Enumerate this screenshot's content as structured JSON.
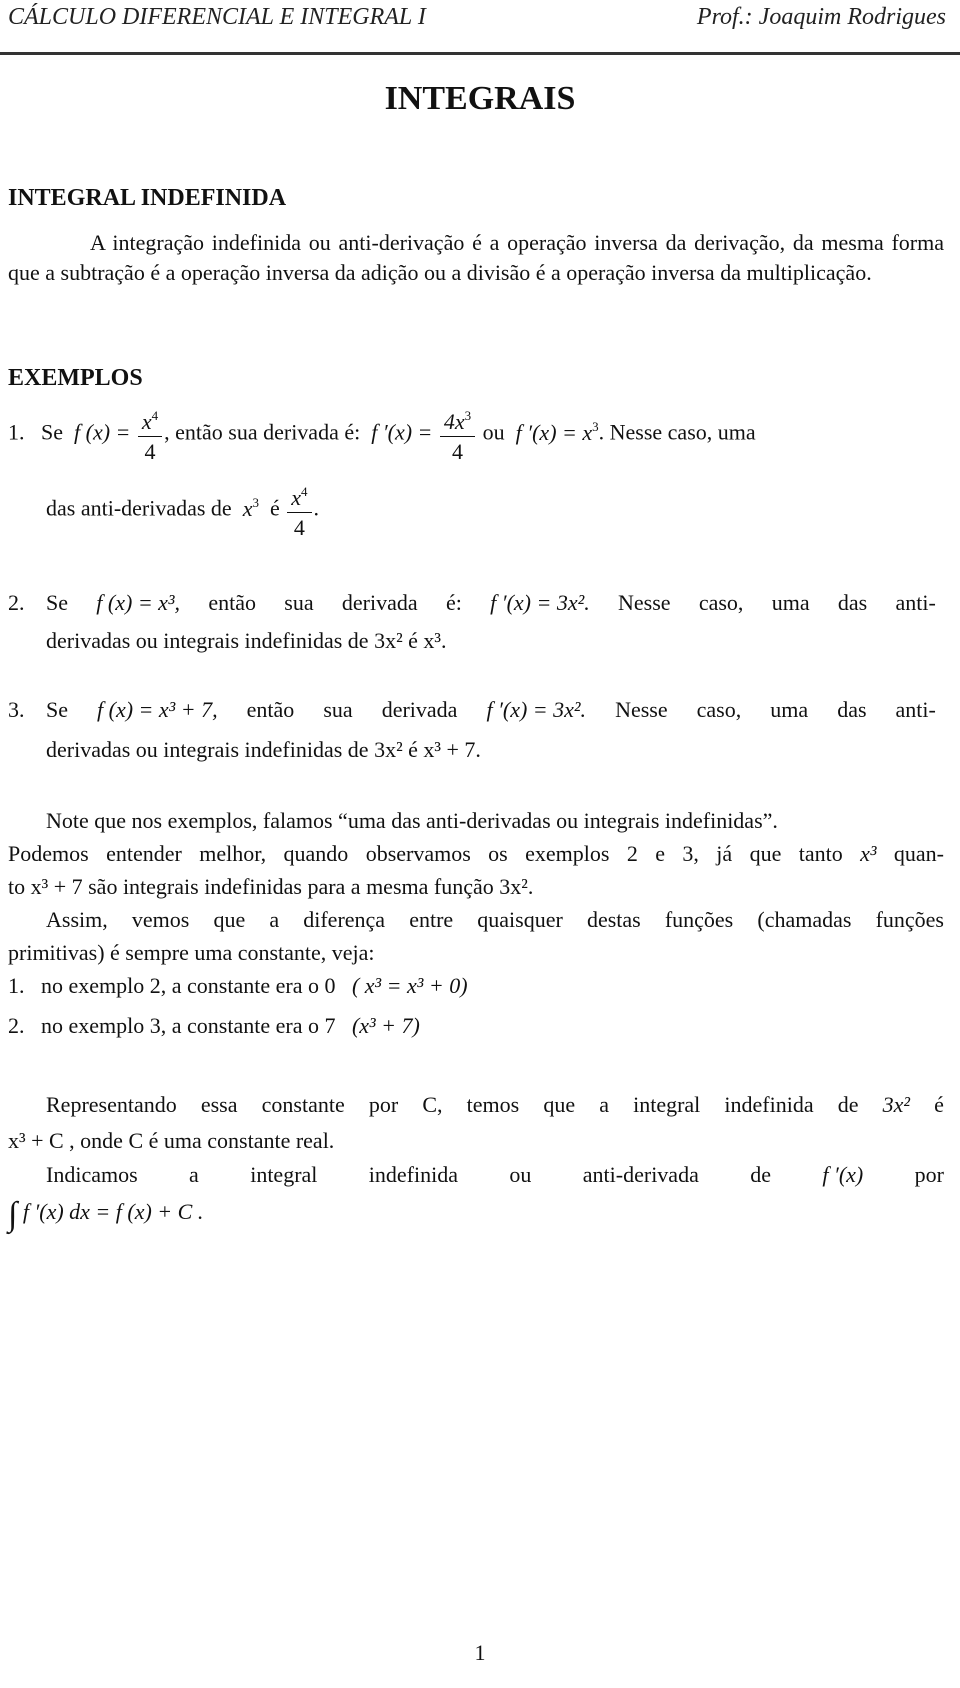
{
  "header": {
    "course": "CÁLCULO DIFERENCIAL E INTEGRAL I",
    "professor": "Prof.: Joaquim Rodrigues"
  },
  "title": "INTEGRAIS",
  "section_heading": "INTEGRAL INDEFINIDA",
  "intro": "A integração indefinida ou anti-derivação é a operação inversa da derivação, da mesma forma que a subtração é a operação inversa da adição ou a divisão é a operação inversa da multiplicação.",
  "examples_heading": "EXEMPLOS",
  "example1": {
    "num": "1.",
    "se": "Se",
    "fx": "f (x) =",
    "frac1_num": "x",
    "frac1_num_exp": "4",
    "frac1_den": "4",
    "text_mid": ", então sua derivada é:",
    "fpx": "f ′(x) =",
    "frac2_num": "4x",
    "frac2_num_exp": "3",
    "frac2_den": "4",
    "ou": "ou",
    "fpx2": "f ′(x) = x",
    "fpx2_exp": "3",
    "tail": ". Nesse caso, uma",
    "line2_text": "das anti-derivadas de",
    "line2_x": "x",
    "line2_exp": "3",
    "line2_e": "é",
    "frac3_num": "x",
    "frac3_num_exp": "4",
    "frac3_den": "4",
    "line2_end": "."
  },
  "example2": {
    "num": "2.",
    "line1_words": [
      "Se",
      "f (x) = x³,",
      "então",
      "sua",
      "derivada",
      "é:",
      "f ′(x) = 3x².",
      "Nesse",
      "caso,",
      "uma",
      "das",
      "anti-"
    ],
    "line2": "derivadas ou integrais indefinidas de 3x² é x³."
  },
  "example3": {
    "num": "3.",
    "line1_words": [
      "Se",
      "f (x) = x³ + 7,",
      "então",
      "sua",
      "derivada",
      "f ′(x) = 3x².",
      "Nesse",
      "caso,",
      "uma",
      "das",
      "anti-"
    ],
    "line2": "derivadas ou integrais indefinidas de 3x² é x³ + 7."
  },
  "note": {
    "line1": "Note que nos exemplos, falamos “uma das anti-derivadas ou integrais indefinidas”.",
    "line2_words": [
      "Podemos",
      "entender",
      "melhor,",
      "quando",
      "observamos",
      "os",
      "exemplos",
      "2",
      "e",
      "3,",
      "já",
      "que",
      "tanto",
      "x³",
      "quan-"
    ],
    "line3": "to x³ + 7 são integrais indefinidas para a mesma função 3x².",
    "line4_words": [
      "Assim,",
      "vemos",
      "que",
      "a",
      "diferença",
      "entre",
      "quaisquer",
      "destas",
      "funções",
      "(chamadas",
      "funções"
    ],
    "line5": "primitivas) é sempre uma constante, veja:"
  },
  "constants_list": [
    {
      "num": "1.",
      "text": "no exemplo 2, a constante era o 0",
      "formula": "( x³ = x³ + 0)"
    },
    {
      "num": "2.",
      "text": "no exemplo 3, a constante era o 7",
      "formula": "(x³ + 7)"
    }
  ],
  "representation": {
    "line1_words": [
      "Representando",
      "essa",
      "constante",
      "por",
      "C,",
      "temos",
      "que",
      "a",
      "integral",
      "indefinida",
      "de",
      "3x²",
      "é"
    ],
    "line2": "x³ + C , onde C é uma constante real.",
    "line3_words": [
      "Indicamos",
      "a",
      "integral",
      "indefinida",
      "ou",
      "anti-derivada",
      "de",
      "f ′(x)",
      "por"
    ],
    "integral_symbol": "∫",
    "formula": "f ′(x) dx = f (x) + C ."
  },
  "page_number": "1"
}
